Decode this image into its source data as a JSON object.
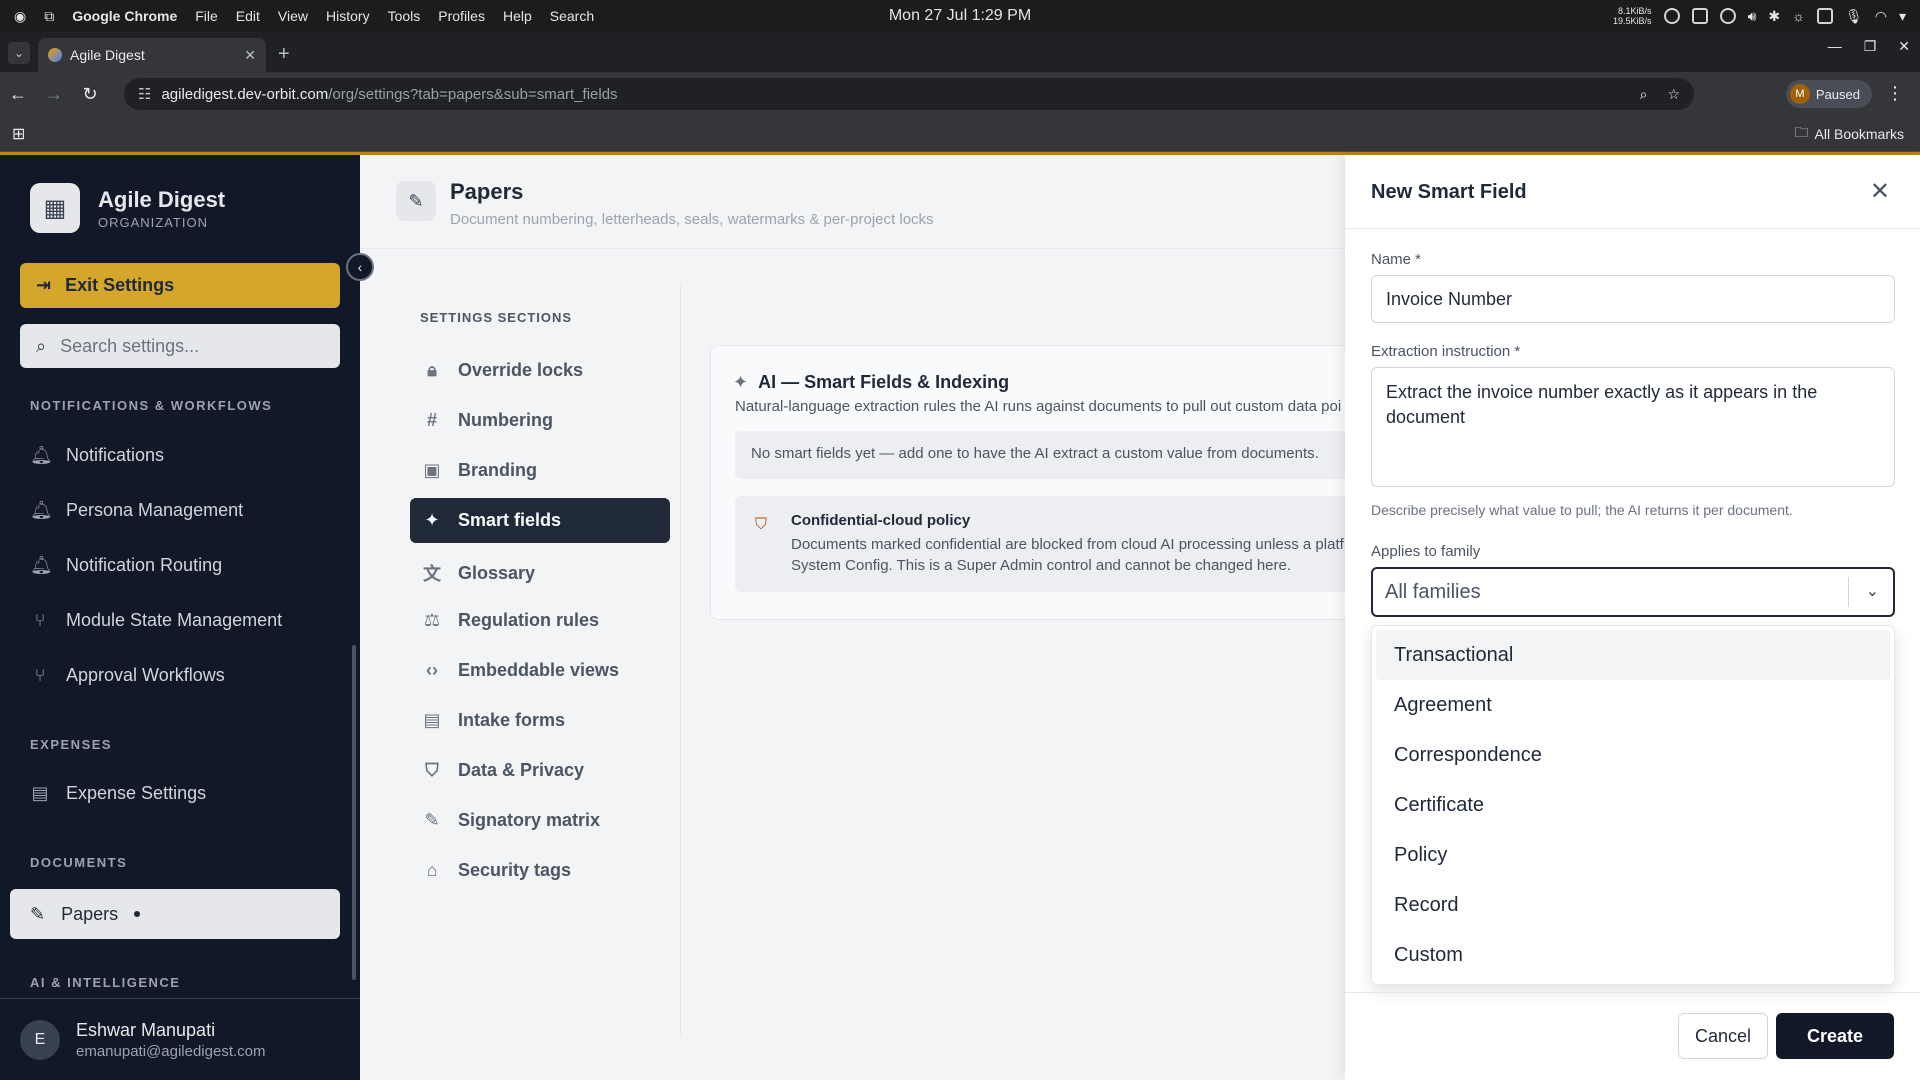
{
  "os": {
    "app_name": "Google Chrome",
    "menu": [
      "File",
      "Edit",
      "View",
      "History",
      "Tools",
      "Profiles",
      "Help",
      "Search"
    ],
    "clock": "Mon 27 Jul  1:29 PM",
    "net_up": "8.1KiB/s",
    "net_down": "19.5KiB/s"
  },
  "browser": {
    "tab_title": "Agile Digest",
    "url_domain": "agiledigest.dev-orbit.com",
    "url_path": "/org/settings?tab=papers&sub=smart_fields",
    "profile_initial": "M",
    "profile_status": "Paused",
    "bookmarks_label": "All Bookmarks"
  },
  "sidebar": {
    "org_name": "Agile Digest",
    "org_type": "ORGANIZATION",
    "exit_label": "Exit Settings",
    "search_placeholder": "Search settings...",
    "sections": [
      {
        "title": "NOTIFICATIONS & WORKFLOWS",
        "items": [
          "Notifications",
          "Persona Management",
          "Notification Routing",
          "Module State Management",
          "Approval Workflows"
        ]
      },
      {
        "title": "EXPENSES",
        "items": [
          "Expense Settings"
        ]
      },
      {
        "title": "DOCUMENTS",
        "items": [
          "Papers"
        ]
      },
      {
        "title": "AI & INTELLIGENCE",
        "items": []
      }
    ],
    "user": {
      "initial": "E",
      "name": "Eshwar Manupati",
      "email": "emanupati@agiledigest.com"
    }
  },
  "main": {
    "title": "Papers",
    "subtitle": "Document numbering, letterheads, seals, watermarks & per-project locks",
    "sections_label": "SETTINGS SECTIONS",
    "sections": [
      "Override locks",
      "Numbering",
      "Branding",
      "Smart fields",
      "Glossary",
      "Regulation rules",
      "Embeddable views",
      "Intake forms",
      "Data & Privacy",
      "Signatory matrix",
      "Security tags"
    ],
    "active_section": "Smart fields",
    "card": {
      "title": "AI — Smart Fields & Indexing",
      "description": "Natural-language extraction rules the AI runs against documents to pull out custom data poi",
      "empty_text": "No smart fields yet — add one to have the AI extract a custom value from documents.",
      "policy_title": "Confidential-cloud policy",
      "policy_line1": "Documents marked confidential are blocked from cloud AI processing unless a platf",
      "policy_line2": "System Config. This is a Super Admin control and cannot be changed here."
    }
  },
  "dialog": {
    "title": "New Smart Field",
    "name_label": "Name *",
    "name_value": "Invoice Number",
    "instruction_label": "Extraction instruction *",
    "instruction_value": "Extract the invoice number exactly as it appears in the document",
    "instruction_hint": "Describe precisely what value to pull; the AI returns it per document.",
    "family_label": "Applies to family",
    "family_selected": "All families",
    "family_options": [
      "Transactional",
      "Agreement",
      "Correspondence",
      "Certificate",
      "Policy",
      "Record",
      "Custom"
    ],
    "cancel_label": "Cancel",
    "create_label": "Create"
  },
  "colors": {
    "accent_gold": "#d4a72c",
    "sidebar_bg": "#111827",
    "primary_dark": "#111827",
    "policy_icon": "#b45309"
  }
}
